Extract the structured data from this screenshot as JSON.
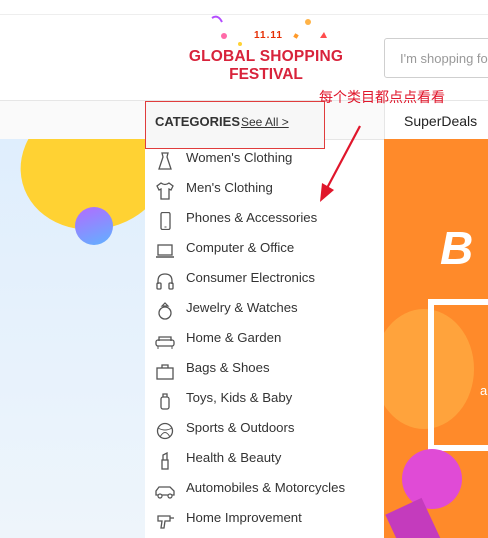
{
  "header": {
    "logo_badge": "11.11",
    "logo_line1": "GLOBAL SHOPPING",
    "logo_line2": "FESTIVAL",
    "search_placeholder": "I'm shopping fo"
  },
  "nav": {
    "categories_title": "CATEGORIES",
    "see_all": "See All >",
    "superdeals": "SuperDeals"
  },
  "annotation": "每个类目都点点看看",
  "categories": [
    {
      "label": "Women's Clothing",
      "icon": "dress-icon"
    },
    {
      "label": "Men's Clothing",
      "icon": "tshirt-icon"
    },
    {
      "label": "Phones & Accessories",
      "icon": "phone-icon"
    },
    {
      "label": "Computer & Office",
      "icon": "laptop-icon"
    },
    {
      "label": "Consumer Electronics",
      "icon": "headphones-icon"
    },
    {
      "label": "Jewelry & Watches",
      "icon": "ring-icon"
    },
    {
      "label": "Home & Garden",
      "icon": "sofa-icon"
    },
    {
      "label": "Bags & Shoes",
      "icon": "bag-icon"
    },
    {
      "label": "Toys, Kids & Baby",
      "icon": "bottle-icon"
    },
    {
      "label": "Sports & Outdoors",
      "icon": "ball-icon"
    },
    {
      "label": "Health & Beauty",
      "icon": "lipstick-icon"
    },
    {
      "label": "Automobiles & Motorcycles",
      "icon": "car-icon"
    },
    {
      "label": "Home Improvement",
      "icon": "drill-icon"
    }
  ],
  "promo": {
    "big_text": "B",
    "small_text": "a"
  },
  "colors": {
    "accent_red": "#d8233b",
    "annotation_red": "#e0162b",
    "promo_orange": "#ff8a2a"
  }
}
